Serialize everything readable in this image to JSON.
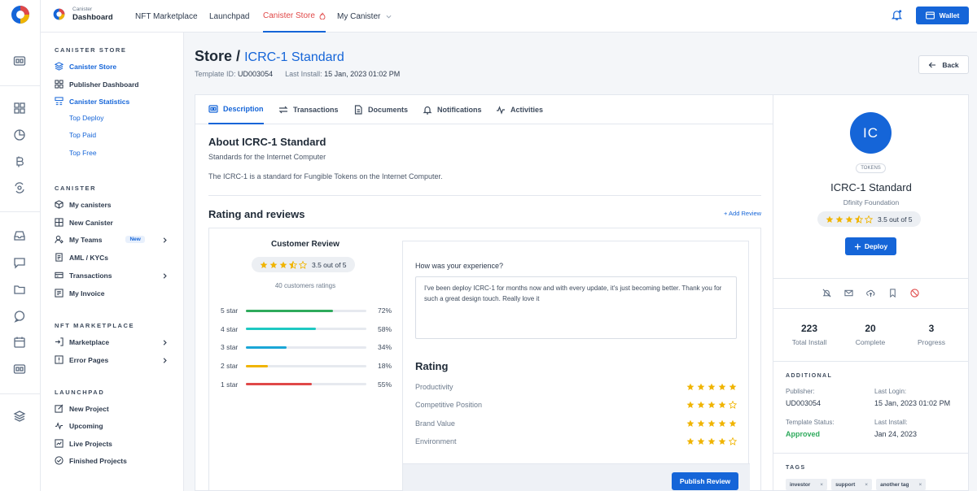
{
  "brand": {
    "small": "Canister",
    "big": "Dashboard"
  },
  "nav": [
    {
      "label": "NFT Marketplace"
    },
    {
      "label": "Launchpad"
    },
    {
      "label": "Canister Store"
    },
    {
      "label": "My Canister"
    }
  ],
  "wallet_label": "Wallet",
  "sidebar": {
    "store_heading": "CANISTER STORE",
    "store_items": [
      "Canister Store",
      "Publisher Dashboard",
      "Canister Statistics"
    ],
    "stat_subs": [
      "Top Deploy",
      "Top Paid",
      "Top Free"
    ],
    "canister_heading": "CANISTER",
    "canister_items": [
      "My canisters",
      "New Canister",
      "My Teams",
      "AML / KYCs",
      "Transactions",
      "My Invoice"
    ],
    "new_badge": "New",
    "nft_heading": "NFT MARKETPLACE",
    "nft_items": [
      "Marketplace",
      "Error Pages"
    ],
    "launch_heading": "LAUNCHPAD",
    "launch_items": [
      "New Project",
      "Upcoming",
      "Live Projects",
      "Finished Projects"
    ]
  },
  "page": {
    "title": "Store",
    "slash": "/",
    "subtitle": "ICRC-1 Standard",
    "template_label": "Template ID:",
    "template_id": "UD003054",
    "install_label": "Last Install:",
    "install_value": "15 Jan, 2023 01:02 PM",
    "back_label": "Back"
  },
  "tabs": [
    "Description",
    "Transactions",
    "Documents",
    "Notifications",
    "Activities"
  ],
  "about": {
    "title": "About ICRC-1 Standard",
    "subtitle": "Standards for the Internet Computer",
    "description": "The ICRC-1 is a standard for Fungible Tokens on the Internet Computer."
  },
  "reviews": {
    "title": "Rating and reviews",
    "add_label": "+ Add Review",
    "customer_title": "Customer Review",
    "score_text": "3.5 out of 5",
    "score": 3.5,
    "count_text": "40 customers ratings",
    "bars": [
      {
        "label": "5 star",
        "pct": 72,
        "pct_text": "72%",
        "color": "#2eaa5c"
      },
      {
        "label": "4 star",
        "pct": 58,
        "pct_text": "58%",
        "color": "#1ec8c2"
      },
      {
        "label": "3 star",
        "pct": 34,
        "pct_text": "34%",
        "color": "#1aa6d6"
      },
      {
        "label": "2 star",
        "pct": 18,
        "pct_text": "18%",
        "color": "#f0b400"
      },
      {
        "label": "1 star",
        "pct": 55,
        "pct_text": "55%",
        "color": "#e04848"
      }
    ],
    "question": "How was your experience?",
    "review_text": "I've been deploy ICRC-1 for months now and with every update, it's just becoming better. Thank you for such a great design touch. Really love it",
    "rating_title": "Rating",
    "rating_rows": [
      {
        "label": "Productivity",
        "stars": 5
      },
      {
        "label": "Competitive Position",
        "stars": 4
      },
      {
        "label": "Brand Value",
        "stars": 5
      },
      {
        "label": "Environment",
        "stars": 4
      }
    ],
    "publish_label": "Publish Review"
  },
  "panel": {
    "initials": "IC",
    "badge": "TOKENS",
    "name": "ICRC-1 Standard",
    "org": "Dfinity Foundation",
    "score_text": "3.5 out of 5",
    "deploy_label": "Deploy",
    "stats": [
      {
        "value": "223",
        "label": "Total Install"
      },
      {
        "value": "20",
        "label": "Complete"
      },
      {
        "value": "3",
        "label": "Progress"
      }
    ],
    "additional_heading": "ADDITIONAL",
    "publisher_label": "Publisher:",
    "publisher_value": "UD003054",
    "login_label": "Last Login:",
    "login_value": "15 Jan, 2023 01:02 PM",
    "status_label": "Template Status:",
    "status_value": "Approved",
    "install_label": "Last Install:",
    "install_value": "Jan 24, 2023",
    "tags_heading": "TAGS",
    "tags": [
      "investor",
      "support",
      "another tag"
    ],
    "tag_remove": "×"
  },
  "colors": {
    "accent": "#1565d8",
    "star": "#f0b400",
    "approved": "#2eaa5c",
    "active_nav": "#e04848"
  }
}
